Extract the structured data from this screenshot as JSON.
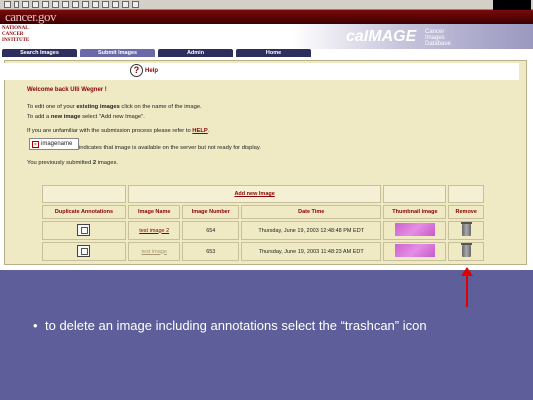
{
  "header": {
    "site_logo": "cancer.gov",
    "nci_text": "NATIONAL CANCER INSTITUTE",
    "brand": "caIMAGE",
    "brand_sub": "Cancer Images Database"
  },
  "nav": {
    "tabs": [
      {
        "label": "Search Images"
      },
      {
        "label": "Submit Images"
      },
      {
        "label": "Admin"
      },
      {
        "label": "Home"
      }
    ]
  },
  "help": {
    "label": "Help"
  },
  "content": {
    "welcome": "Welcome back Ulli Wegner !",
    "line1_pre": "To edit one of your ",
    "line1_bold": "existing images",
    "line1_post": " click on the name of the image.",
    "line2_pre": "To add a ",
    "line2_bold": "new image",
    "line2_post": " select \"Add new Image\".",
    "line3_pre": "If you are unfamiliar with the submission process please refer to ",
    "line3_link": "HELP",
    "line3_post": ".",
    "legend_label": "imagename",
    "legend_text": "indicates that image is available on the server but not ready for display.",
    "submitted_pre": "You previously submitted ",
    "submitted_count": "2",
    "submitted_post": " images."
  },
  "table": {
    "add_new": "Add new Image",
    "headers": [
      "Duplicate Annotations",
      "Image Name",
      "Image Number",
      "Date Time",
      "Thumbnail image",
      "Remove"
    ],
    "rows": [
      {
        "name": "test image 2",
        "number": "654",
        "datetime": "Thursday, June 19, 2003 12:48:48 PM EDT"
      },
      {
        "name": "test image",
        "number": "653",
        "datetime": "Thursday, June 19, 2003 11:48:23 AM EDT"
      }
    ]
  },
  "caption": "to delete an image including annotations select the “trashcan” icon"
}
